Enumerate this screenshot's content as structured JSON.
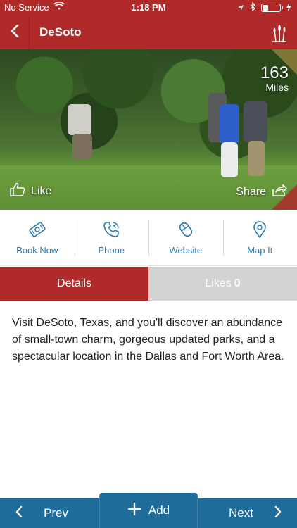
{
  "status_bar": {
    "carrier": "No Service",
    "time": "1:18 PM",
    "battery_level": 0.35
  },
  "nav": {
    "title": "DeSoto",
    "back_icon": "chevron-left-icon",
    "logo_icon": "cattail-logo-icon"
  },
  "hero": {
    "distance_value": "163",
    "distance_unit": "Miles",
    "like_label": "Like",
    "share_label": "Share"
  },
  "actions": [
    {
      "label": "Book Now",
      "icon": "ticket-icon"
    },
    {
      "label": "Phone",
      "icon": "phone-icon"
    },
    {
      "label": "Website",
      "icon": "mouse-icon"
    },
    {
      "label": "Map It",
      "icon": "map-pin-icon"
    }
  ],
  "tabs": {
    "details_label": "Details",
    "likes_label": "Likes",
    "likes_count": "0"
  },
  "description": "Visit DeSoto, Texas, and you'll discover an abundance of small-town charm, gorgeous updated parks, and a spectacular location in the Dallas and Fort Worth Area.",
  "bottom_bar": {
    "prev_label": "Prev",
    "add_label": "Add",
    "next_label": "Next"
  },
  "colors": {
    "brand_red": "#b02a2a",
    "brand_blue": "#1f6b9a",
    "action_blue": "#2a7cb8",
    "tab_inactive": "#d3d3d3"
  }
}
